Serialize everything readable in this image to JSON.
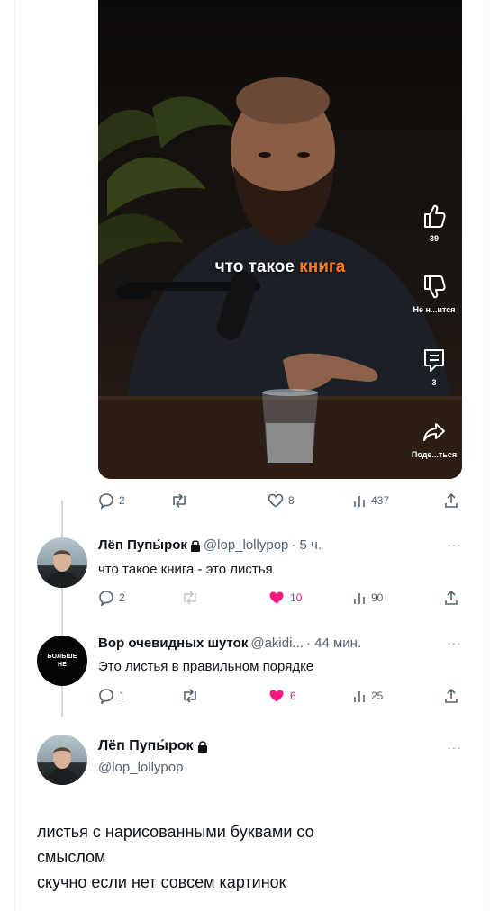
{
  "video": {
    "caption_start": "что такое ",
    "caption_highlight": "книга",
    "like_count": "39",
    "dislike_label": "Не н...ится",
    "comment_count": "3",
    "share_label": "Поде...ться"
  },
  "post_actions": {
    "replies": "2",
    "reposts": "",
    "likes": "8",
    "views": "437"
  },
  "replies": [
    {
      "name": "Лёп Пупы́рок",
      "handle": "@lop_lollypop",
      "time": "· 5 ч.",
      "text": "что такое книга - это листья",
      "replies": "2",
      "likes": "10",
      "views": "90"
    },
    {
      "name": "Вор очевидных шуток",
      "handle": "@akidi...",
      "time": "· 44 мин.",
      "avatar_text": "БОЛЬШЕ НЕ",
      "text": "Это листья в правильном порядке",
      "replies": "1",
      "likes": "6",
      "views": "25"
    }
  ],
  "main_post": {
    "name": "Лёп Пупы́рок",
    "handle": "@lop_lollypop",
    "line1": "листья с нарисованными буквами со",
    "line2": "смыслом",
    "line3": "скучно если нет совсем картинок"
  },
  "more_glyph": "···",
  "colors": {
    "like_active": "#f91880",
    "secondary_text": "#536471",
    "caption_highlight": "#ff7a12"
  }
}
